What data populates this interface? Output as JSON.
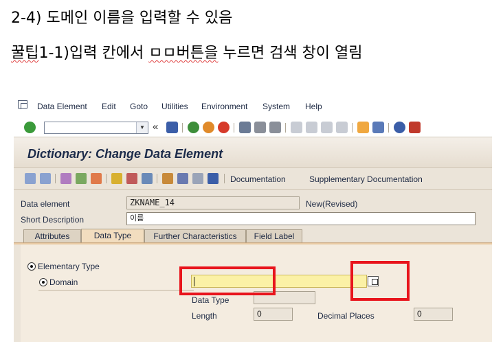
{
  "caption": {
    "line1": "2-4) 도메인 이름을 입력할 수 있음",
    "line2_prefix": "꿀팁",
    "line2_mid": "1-1)입력 칸에서 ",
    "line2_glyph": "ㅁㅁ버튼을",
    "line2_suffix": " 누르면 검색 창이 열림"
  },
  "menu": [
    "Data Element",
    "Edit",
    "Goto",
    "Utilities",
    "Environment",
    "System",
    "Help"
  ],
  "toolbar": {
    "ok_code_value": "",
    "back_symbol": "«"
  },
  "title": "Dictionary: Change Data Element",
  "app_toolbar": {
    "documentation": "Documentation",
    "supplementary": "Supplementary Documentation"
  },
  "header": {
    "data_element_label": "Data element",
    "data_element_value": "ZKNAME_14",
    "status": "New(Revised)",
    "short_desc_label": "Short Description",
    "short_desc_value": "이름"
  },
  "tabs": [
    "Attributes",
    "Data Type",
    "Further Characteristics",
    "Field Label"
  ],
  "active_tab": "Data Type",
  "data_type_tab": {
    "elementary_type": "Elementary Type",
    "domain": "Domain",
    "domain_value": "",
    "data_type_label": "Data Type",
    "data_type_value": "",
    "length_label": "Length",
    "length_value": "0",
    "decimal_label": "Decimal Places",
    "decimal_value": "0"
  },
  "colors": {
    "highlight_red": "#e8141c",
    "required_field": "#fbf1a6",
    "sap_background": "#ebe4d9",
    "title_text": "#1c2b4a"
  },
  "icons": [
    "menu-icon",
    "enter-icon",
    "save-icon",
    "back-icon",
    "exit-icon",
    "cancel-icon",
    "print-icon",
    "find-icon",
    "help-icon"
  ]
}
